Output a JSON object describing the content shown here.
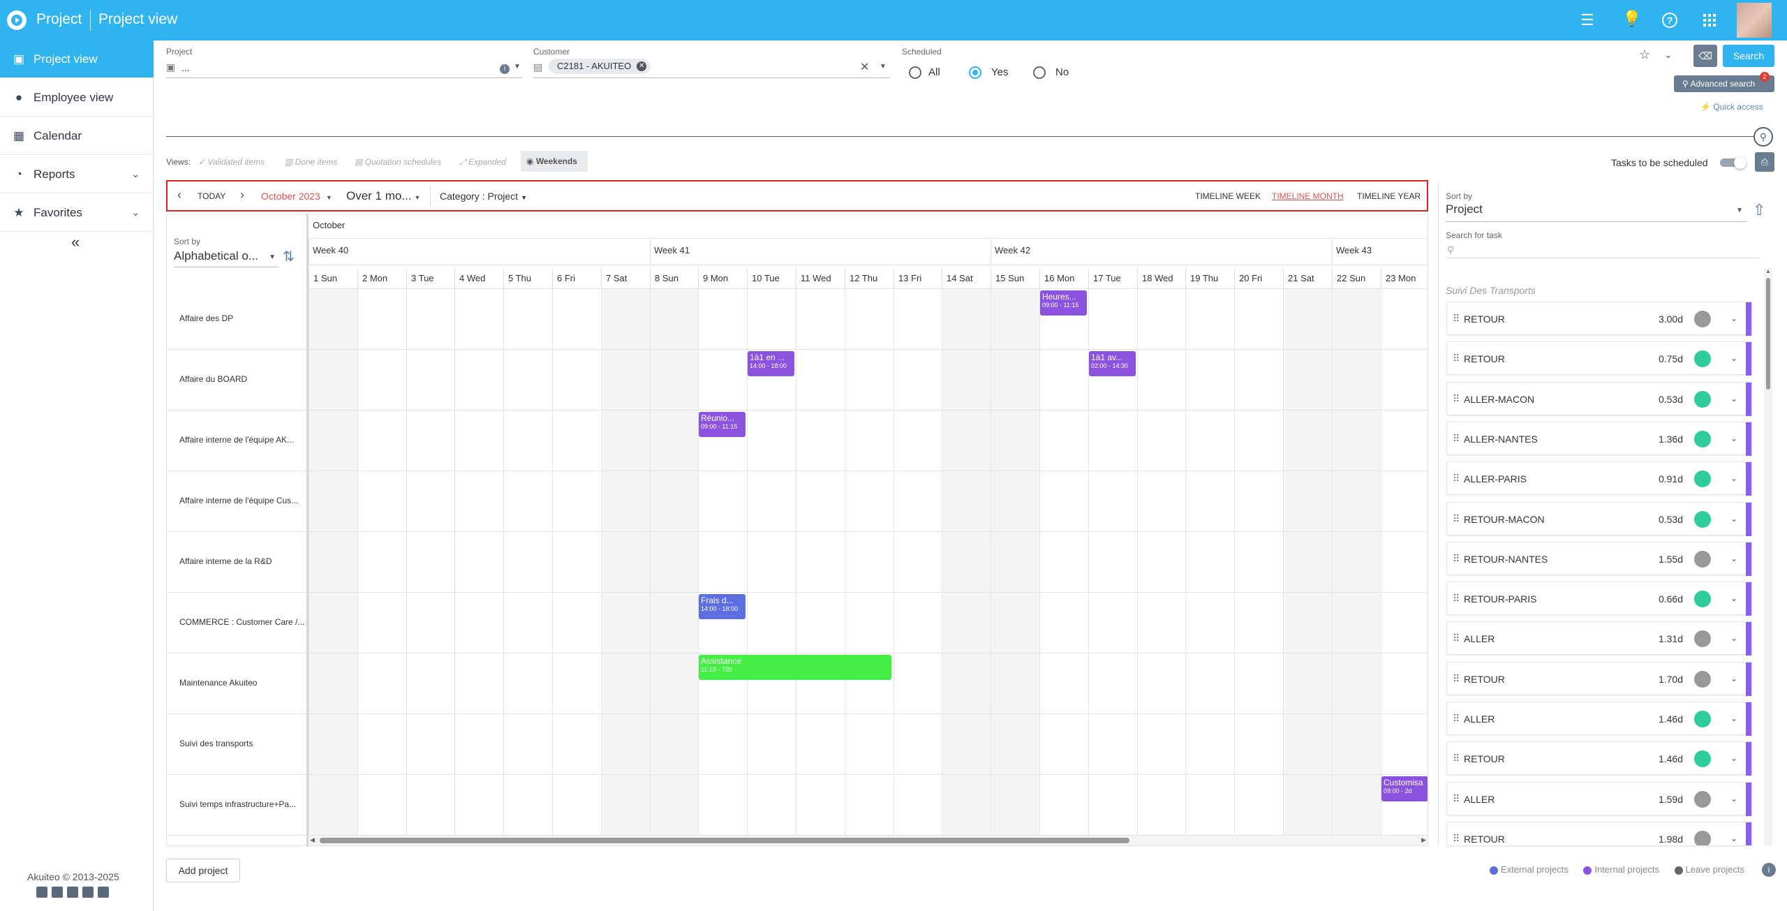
{
  "header": {
    "app": "Project",
    "title": "Project view"
  },
  "sidebar": {
    "items": [
      {
        "label": "Project view"
      },
      {
        "label": "Employee view"
      },
      {
        "label": "Calendar"
      },
      {
        "label": "Reports"
      },
      {
        "label": "Favorites"
      }
    ],
    "collapse": "«",
    "footer": "Akuiteo © 2013-2025"
  },
  "filters": {
    "project_label": "Project",
    "project_value": "...",
    "customer_label": "Customer",
    "customer_chip": "C2181 - AKUITEO",
    "scheduled_label": "Scheduled",
    "opt_all": "All",
    "opt_yes": "Yes",
    "opt_no": "No",
    "search": "Search",
    "advanced_search": "Advanced search",
    "advanced_badge": "2",
    "quick_access": "Quick access"
  },
  "views": {
    "label": "Views:",
    "items": [
      "Validated items",
      "Done items",
      "Quotation schedules",
      "Expanded",
      "Weekends"
    ]
  },
  "toggle_label": "Tasks to be scheduled",
  "toolbar": {
    "today": "TODAY",
    "month": "October 2023",
    "span": "Over 1 mo...",
    "category": "Category : Project",
    "tl_week": "TIMELINE WEEK",
    "tl_month": "TIMELINE MONTH",
    "tl_year": "TIMELINE YEAR"
  },
  "left_sort": {
    "label": "Sort by",
    "value": "Alphabetical o..."
  },
  "calendar": {
    "month": "October",
    "weeks": [
      "Week 40",
      "Week 41",
      "Week 42",
      "Week 43"
    ],
    "days": [
      "1 Sun",
      "2 Mon",
      "3 Tue",
      "4 Wed",
      "5 Thu",
      "6 Fri",
      "7 Sat",
      "8 Sun",
      "9 Mon",
      "10 Tue",
      "11 Wed",
      "12 Thu",
      "13 Fri",
      "14 Sat",
      "15 Sun",
      "16 Mon",
      "17 Tue",
      "18 Wed",
      "19 Thu",
      "20 Fri",
      "21 Sat",
      "22 Sun",
      "23 Mon"
    ],
    "rows": [
      "Affaire des DP",
      "Affaire du BOARD",
      "Affaire interne de l'équipe AK...",
      "Affaire interne de l'équipe Cus...",
      "Affaire interne de la R&D",
      "COMMERCE : Customer Care /...",
      "Maintenance Akuiteo",
      "Suivi des transports",
      "Suivi temps infrastructure+Pa..."
    ],
    "events": [
      {
        "title": "Heures...",
        "sub": "09:00 - 11:15",
        "color": "#8b52e0"
      },
      {
        "title": "1à1 en ...",
        "sub": "14:00 - 18:00",
        "color": "#8b52e0"
      },
      {
        "title": "1à1 av...",
        "sub": "02:00 - 14:30",
        "color": "#8b52e0"
      },
      {
        "title": "Réunio...",
        "sub": "09:00 - 11:15",
        "color": "#8b52e0"
      },
      {
        "title": "Frais d...",
        "sub": "14:00 - 18:00",
        "color": "#5b6fe0"
      },
      {
        "title": "Assistance",
        "sub": "11:15 - 72h",
        "color": "#44ee44"
      },
      {
        "title": "Customisa",
        "sub": "09:00 - 2d",
        "color": "#8b52e0"
      }
    ]
  },
  "right_panel": {
    "sort_label": "Sort by",
    "sort_value": "Project",
    "search_label": "Search for task",
    "group": "Suivi Des Transports",
    "tasks": [
      {
        "name": "RETOUR",
        "dur": "3.00d",
        "color": "#999999"
      },
      {
        "name": "RETOUR",
        "dur": "0.75d",
        "color": "#2ecc9a"
      },
      {
        "name": "ALLER-MACON",
        "dur": "0.53d",
        "color": "#2ecc9a"
      },
      {
        "name": "ALLER-NANTES",
        "dur": "1.36d",
        "color": "#2ecc9a"
      },
      {
        "name": "ALLER-PARIS",
        "dur": "0.91d",
        "color": "#2ecc9a"
      },
      {
        "name": "RETOUR-MACON",
        "dur": "0.53d",
        "color": "#2ecc9a"
      },
      {
        "name": "RETOUR-NANTES",
        "dur": "1.55d",
        "color": "#999999"
      },
      {
        "name": "RETOUR-PARIS",
        "dur": "0.66d",
        "color": "#2ecc9a"
      },
      {
        "name": "ALLER",
        "dur": "1.31d",
        "color": "#999999"
      },
      {
        "name": "RETOUR",
        "dur": "1.70d",
        "color": "#999999"
      },
      {
        "name": "ALLER",
        "dur": "1.46d",
        "color": "#2ecc9a"
      },
      {
        "name": "RETOUR",
        "dur": "1.46d",
        "color": "#2ecc9a"
      },
      {
        "name": "ALLER",
        "dur": "1.59d",
        "color": "#999999"
      },
      {
        "name": "RETOUR",
        "dur": "1.98d",
        "color": "#999999"
      }
    ]
  },
  "add_project": "Add project",
  "legend": {
    "external": "External projects",
    "internal": "Internal projects",
    "leave": "Leave projects",
    "external_color": "#5b6fe0",
    "internal_color": "#8b52e0",
    "leave_color": "#666666"
  }
}
